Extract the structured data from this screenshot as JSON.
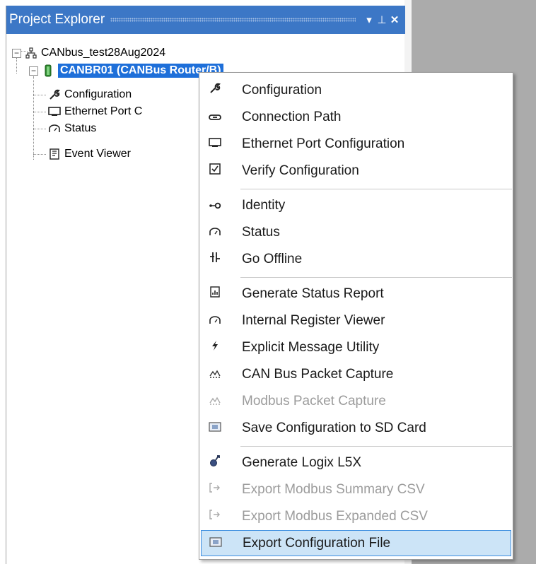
{
  "panel": {
    "title": "Project Explorer",
    "dropdown_glyph": "▾",
    "pin_glyph": "⊥",
    "close_glyph": "✕"
  },
  "tree": {
    "root": {
      "label": "CANbus_test28Aug2024",
      "expander": "−",
      "icon": "network-icon"
    },
    "device": {
      "label": "CANBR01 (CANBus Router/B)",
      "expander": "−",
      "icon": "device-icon",
      "selected": true
    },
    "children": [
      {
        "label": "Configuration",
        "icon": "wrench-icon",
        "glyph": "🔧"
      },
      {
        "label": "Ethernet Port C",
        "icon": "ethernet-port-icon",
        "glyph": "▭"
      },
      {
        "label": "Status",
        "icon": "gauge-icon",
        "glyph": "⌒"
      },
      {
        "label": "Event Viewer",
        "icon": "event-log-icon",
        "glyph": "▤"
      }
    ]
  },
  "context_menu": {
    "items": [
      {
        "label": "Configuration",
        "icon": "wrench-icon",
        "glyph": "🔧",
        "enabled": true
      },
      {
        "label": "Connection Path",
        "icon": "link-icon",
        "glyph": "⊂⊃",
        "enabled": true
      },
      {
        "label": "Ethernet Port Configuration",
        "icon": "ethernet-port-icon",
        "glyph": "▭",
        "enabled": true
      },
      {
        "label": "Verify Configuration",
        "icon": "checkbox-icon",
        "glyph": "☑",
        "enabled": true
      },
      {
        "label": "Identity",
        "icon": "identity-icon",
        "glyph": "•o",
        "enabled": true
      },
      {
        "label": "Status",
        "icon": "gauge-icon",
        "glyph": "⌒",
        "enabled": true
      },
      {
        "label": "Go Offline",
        "icon": "disconnect-icon",
        "glyph": "╪",
        "enabled": true
      },
      {
        "label": "Generate Status Report",
        "icon": "report-icon",
        "glyph": "▤",
        "enabled": true
      },
      {
        "label": "Internal Register Viewer",
        "icon": "gauge-icon",
        "glyph": "⌒",
        "enabled": true
      },
      {
        "label": "Explicit Message Utility",
        "icon": "lightning-icon",
        "glyph": "ϟ",
        "enabled": true
      },
      {
        "label": "CAN Bus Packet Capture",
        "icon": "packet-capture-icon",
        "glyph": "⩠",
        "enabled": true
      },
      {
        "label": "Modbus Packet Capture",
        "icon": "packet-capture-icon",
        "glyph": "⩠",
        "enabled": false
      },
      {
        "label": "Save Configuration to SD Card",
        "icon": "sd-card-icon",
        "glyph": "▣",
        "enabled": true
      },
      {
        "label": "Generate Logix L5X",
        "icon": "logix-icon",
        "glyph": "♂",
        "enabled": true
      },
      {
        "label": "Export Modbus Summary CSV",
        "icon": "export-icon",
        "glyph": "[→",
        "enabled": false
      },
      {
        "label": "Export Modbus Expanded CSV",
        "icon": "export-icon",
        "glyph": "[→",
        "enabled": false
      },
      {
        "label": "Export Configuration File",
        "icon": "export-file-icon",
        "glyph": "▣",
        "enabled": true,
        "highlighted": true
      }
    ]
  },
  "colors": {
    "titlebar": "#3c77c6",
    "selection": "#1e6fd9",
    "menu_highlight": "#cce4f7",
    "menu_highlight_border": "#3d8ee0",
    "disabled_text": "#9c9c9c"
  }
}
